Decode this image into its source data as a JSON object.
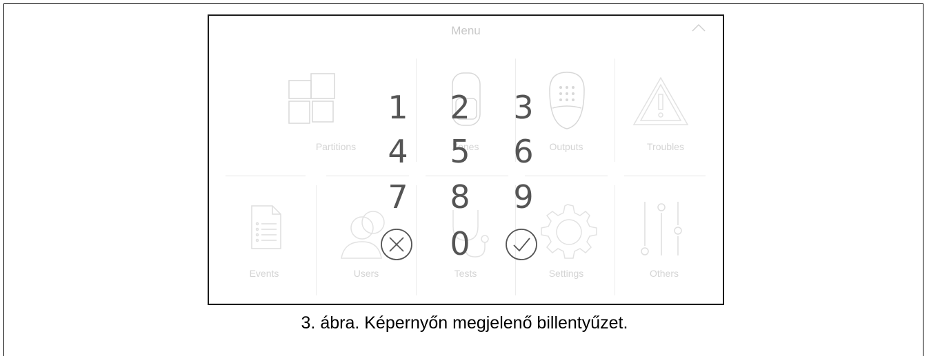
{
  "screen": {
    "title": "Menu",
    "tiles": [
      {
        "label": "Partitions",
        "icon": "partitions-icon"
      },
      {
        "label": "Zones",
        "icon": "zones-icon"
      },
      {
        "label": "Outputs",
        "icon": "outputs-icon"
      },
      {
        "label": "Troubles",
        "icon": "troubles-icon"
      },
      {
        "label": "Events",
        "icon": "events-icon"
      },
      {
        "label": "Users",
        "icon": "users-icon"
      },
      {
        "label": "Tests",
        "icon": "tests-icon"
      },
      {
        "label": "Settings",
        "icon": "settings-icon"
      },
      {
        "label": "Others",
        "icon": "others-icon"
      }
    ]
  },
  "keypad": {
    "keys": [
      "1",
      "2",
      "3",
      "4",
      "5",
      "6",
      "7",
      "8",
      "9",
      "0"
    ],
    "cancel_icon": "cancel-x-icon",
    "confirm_icon": "confirm-check-icon"
  },
  "caption": "3. ábra. Képernyőn megjelenő billentyűzet.",
  "colors": {
    "digits": "#555555",
    "faded_ui": "#d4d4d4",
    "border": "#1a1a1a"
  }
}
